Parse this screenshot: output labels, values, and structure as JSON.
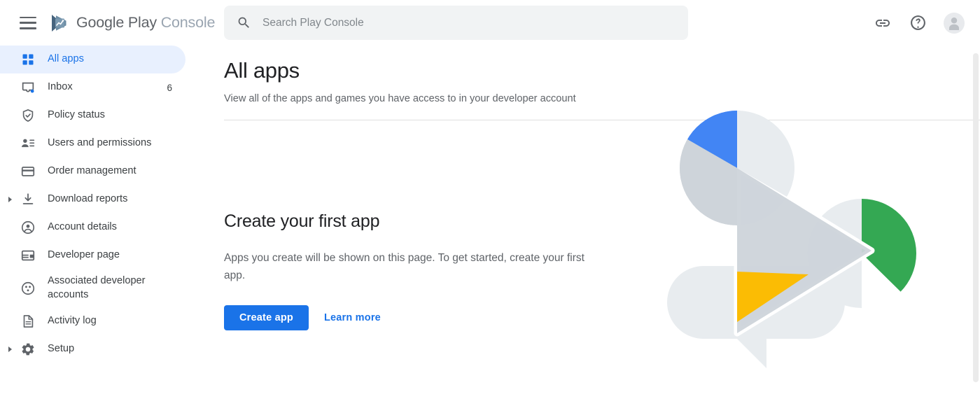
{
  "topbar": {
    "menu_icon": "hamburger-menu-icon",
    "logo_icon": "google-play-console-logo",
    "brand_primary": "Google Play",
    "brand_secondary": "Console",
    "link_icon": "link-icon",
    "help_icon": "help-circle-icon",
    "avatar_icon": "account-avatar-icon"
  },
  "search": {
    "icon": "search-icon",
    "value": "",
    "placeholder": "Search Play Console"
  },
  "sidebar": {
    "items": [
      {
        "label": "All apps",
        "icon": "grid-apps-icon",
        "active": true,
        "expandable": false,
        "badge": ""
      },
      {
        "label": "Inbox",
        "icon": "inbox-icon",
        "active": false,
        "expandable": false,
        "badge": "6"
      },
      {
        "label": "Policy status",
        "icon": "shield-check-icon",
        "active": false,
        "expandable": false,
        "badge": ""
      },
      {
        "label": "Users and permissions",
        "icon": "users-permissions-icon",
        "active": false,
        "expandable": false,
        "badge": ""
      },
      {
        "label": "Order management",
        "icon": "credit-card-icon",
        "active": false,
        "expandable": false,
        "badge": ""
      },
      {
        "label": "Download reports",
        "icon": "download-icon",
        "active": false,
        "expandable": true,
        "badge": ""
      },
      {
        "label": "Account details",
        "icon": "account-circle-icon",
        "active": false,
        "expandable": false,
        "badge": ""
      },
      {
        "label": "Developer page",
        "icon": "developer-page-icon",
        "active": false,
        "expandable": false,
        "badge": ""
      },
      {
        "label": "Associated developer accounts",
        "icon": "associated-accounts-icon",
        "active": false,
        "expandable": false,
        "badge": ""
      },
      {
        "label": "Activity log",
        "icon": "document-icon",
        "active": false,
        "expandable": false,
        "badge": ""
      },
      {
        "label": "Setup",
        "icon": "gear-icon",
        "active": false,
        "expandable": true,
        "badge": ""
      }
    ]
  },
  "main": {
    "page_title": "All apps",
    "page_subtitle": "View all of the apps and games you have access to in your developer account",
    "empty_state": {
      "title": "Create your first app",
      "body": "Apps you create will be shown on this page. To get started, create your first app.",
      "primary_button": "Create app",
      "secondary_link": "Learn more",
      "illustration": "play-console-empty-state-illustration"
    }
  },
  "colors": {
    "brand_blue": "#1a73e8",
    "active_pill": "#e8f0fe",
    "text_primary": "#202124",
    "text_secondary": "#5f6368",
    "search_bg": "#f1f3f4",
    "illustration_blue": "#4285f4",
    "illustration_green": "#34a853",
    "illustration_yellow": "#fbbc04",
    "illustration_gray_dark": "#ced4da",
    "illustration_gray_light": "#e8ecef"
  }
}
